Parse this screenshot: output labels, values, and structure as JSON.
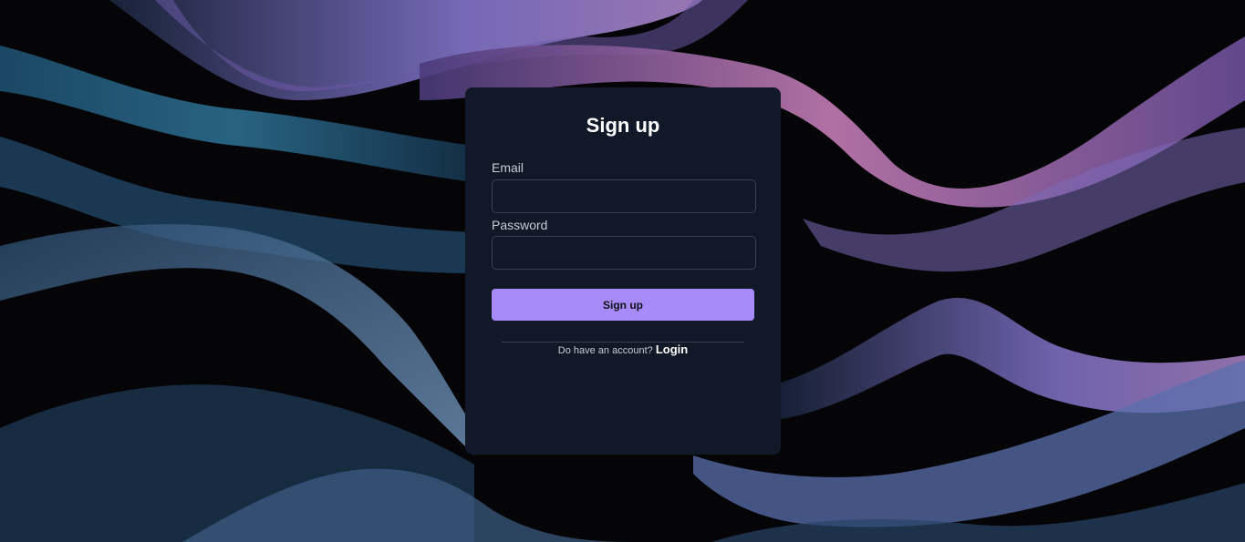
{
  "background": {
    "colors": {
      "base": "#050507",
      "blue": "#2c6d8f",
      "pink": "#c37cb5",
      "violet": "#8a7ad6"
    }
  },
  "signup": {
    "title": "Sign up",
    "email_label": "Email",
    "email_value": "",
    "password_label": "Password",
    "password_value": "",
    "submit_label": "Sign up",
    "account_prompt": "Do have an account?",
    "login_link": "Login"
  },
  "colors": {
    "card_bg": "#111827",
    "accent": "#a78bfa",
    "input_border": "#3b4150"
  }
}
